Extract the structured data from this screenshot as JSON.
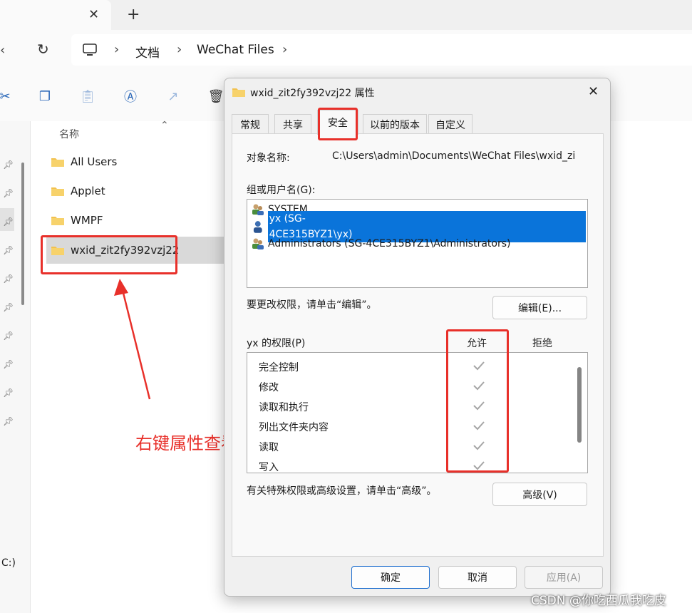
{
  "explorer": {
    "address": {
      "crumbs": [
        "文档",
        "WeChat Files"
      ]
    },
    "columns": {
      "name_header": "名称"
    },
    "folders": [
      "All Users",
      "Applet",
      "WMPF",
      "wxid_zit2fy392vzj22"
    ],
    "nav_drive_fragment": "C:)"
  },
  "dialog": {
    "title": "wxid_zit2fy392vzj22 属性",
    "tabs": [
      "常规",
      "共享",
      "安全",
      "以前的版本",
      "自定义"
    ],
    "active_tab": "安全",
    "object_name_label": "对象名称:",
    "object_name_value": "C:\\Users\\admin\\Documents\\WeChat Files\\wxid_zi",
    "group_label": "组或用户名(G):",
    "users": [
      {
        "name": "SYSTEM",
        "icon": "group-users-icon",
        "selected": false
      },
      {
        "name": "yx (SG-4CE315BYZ1\\yx)",
        "icon": "single-user-icon",
        "selected": true
      },
      {
        "name": "Administrators (SG-4CE315BYZ1\\Administrators)",
        "icon": "group-users-icon",
        "selected": false
      }
    ],
    "edit_hint": "要更改权限，请单击“编辑”。",
    "edit_button": "编辑(E)...",
    "perm_label": "yx 的权限(P)",
    "allow_header": "允许",
    "deny_header": "拒绝",
    "permissions": [
      {
        "name": "完全控制",
        "allow": true,
        "deny": false
      },
      {
        "name": "修改",
        "allow": true,
        "deny": false
      },
      {
        "name": "读取和执行",
        "allow": true,
        "deny": false
      },
      {
        "name": "列出文件夹内容",
        "allow": true,
        "deny": false
      },
      {
        "name": "读取",
        "allow": true,
        "deny": false
      },
      {
        "name": "写入",
        "allow": true,
        "deny": false
      }
    ],
    "advanced_hint": "有关特殊权限或高级设置，请单击“高级”。",
    "advanced_button": "高级(V)",
    "ok_button": "确定",
    "cancel_button": "取消",
    "apply_button": "应用(A)"
  },
  "annotation": {
    "text": "右键属性查看"
  },
  "watermark": "CSDN @你吃西瓜我吃皮",
  "colors": {
    "annotation_red": "#e8302a",
    "selection_blue": "#0a74da",
    "folder_yellow": "#f2c14e",
    "check_gray": "#a6a6a6"
  }
}
